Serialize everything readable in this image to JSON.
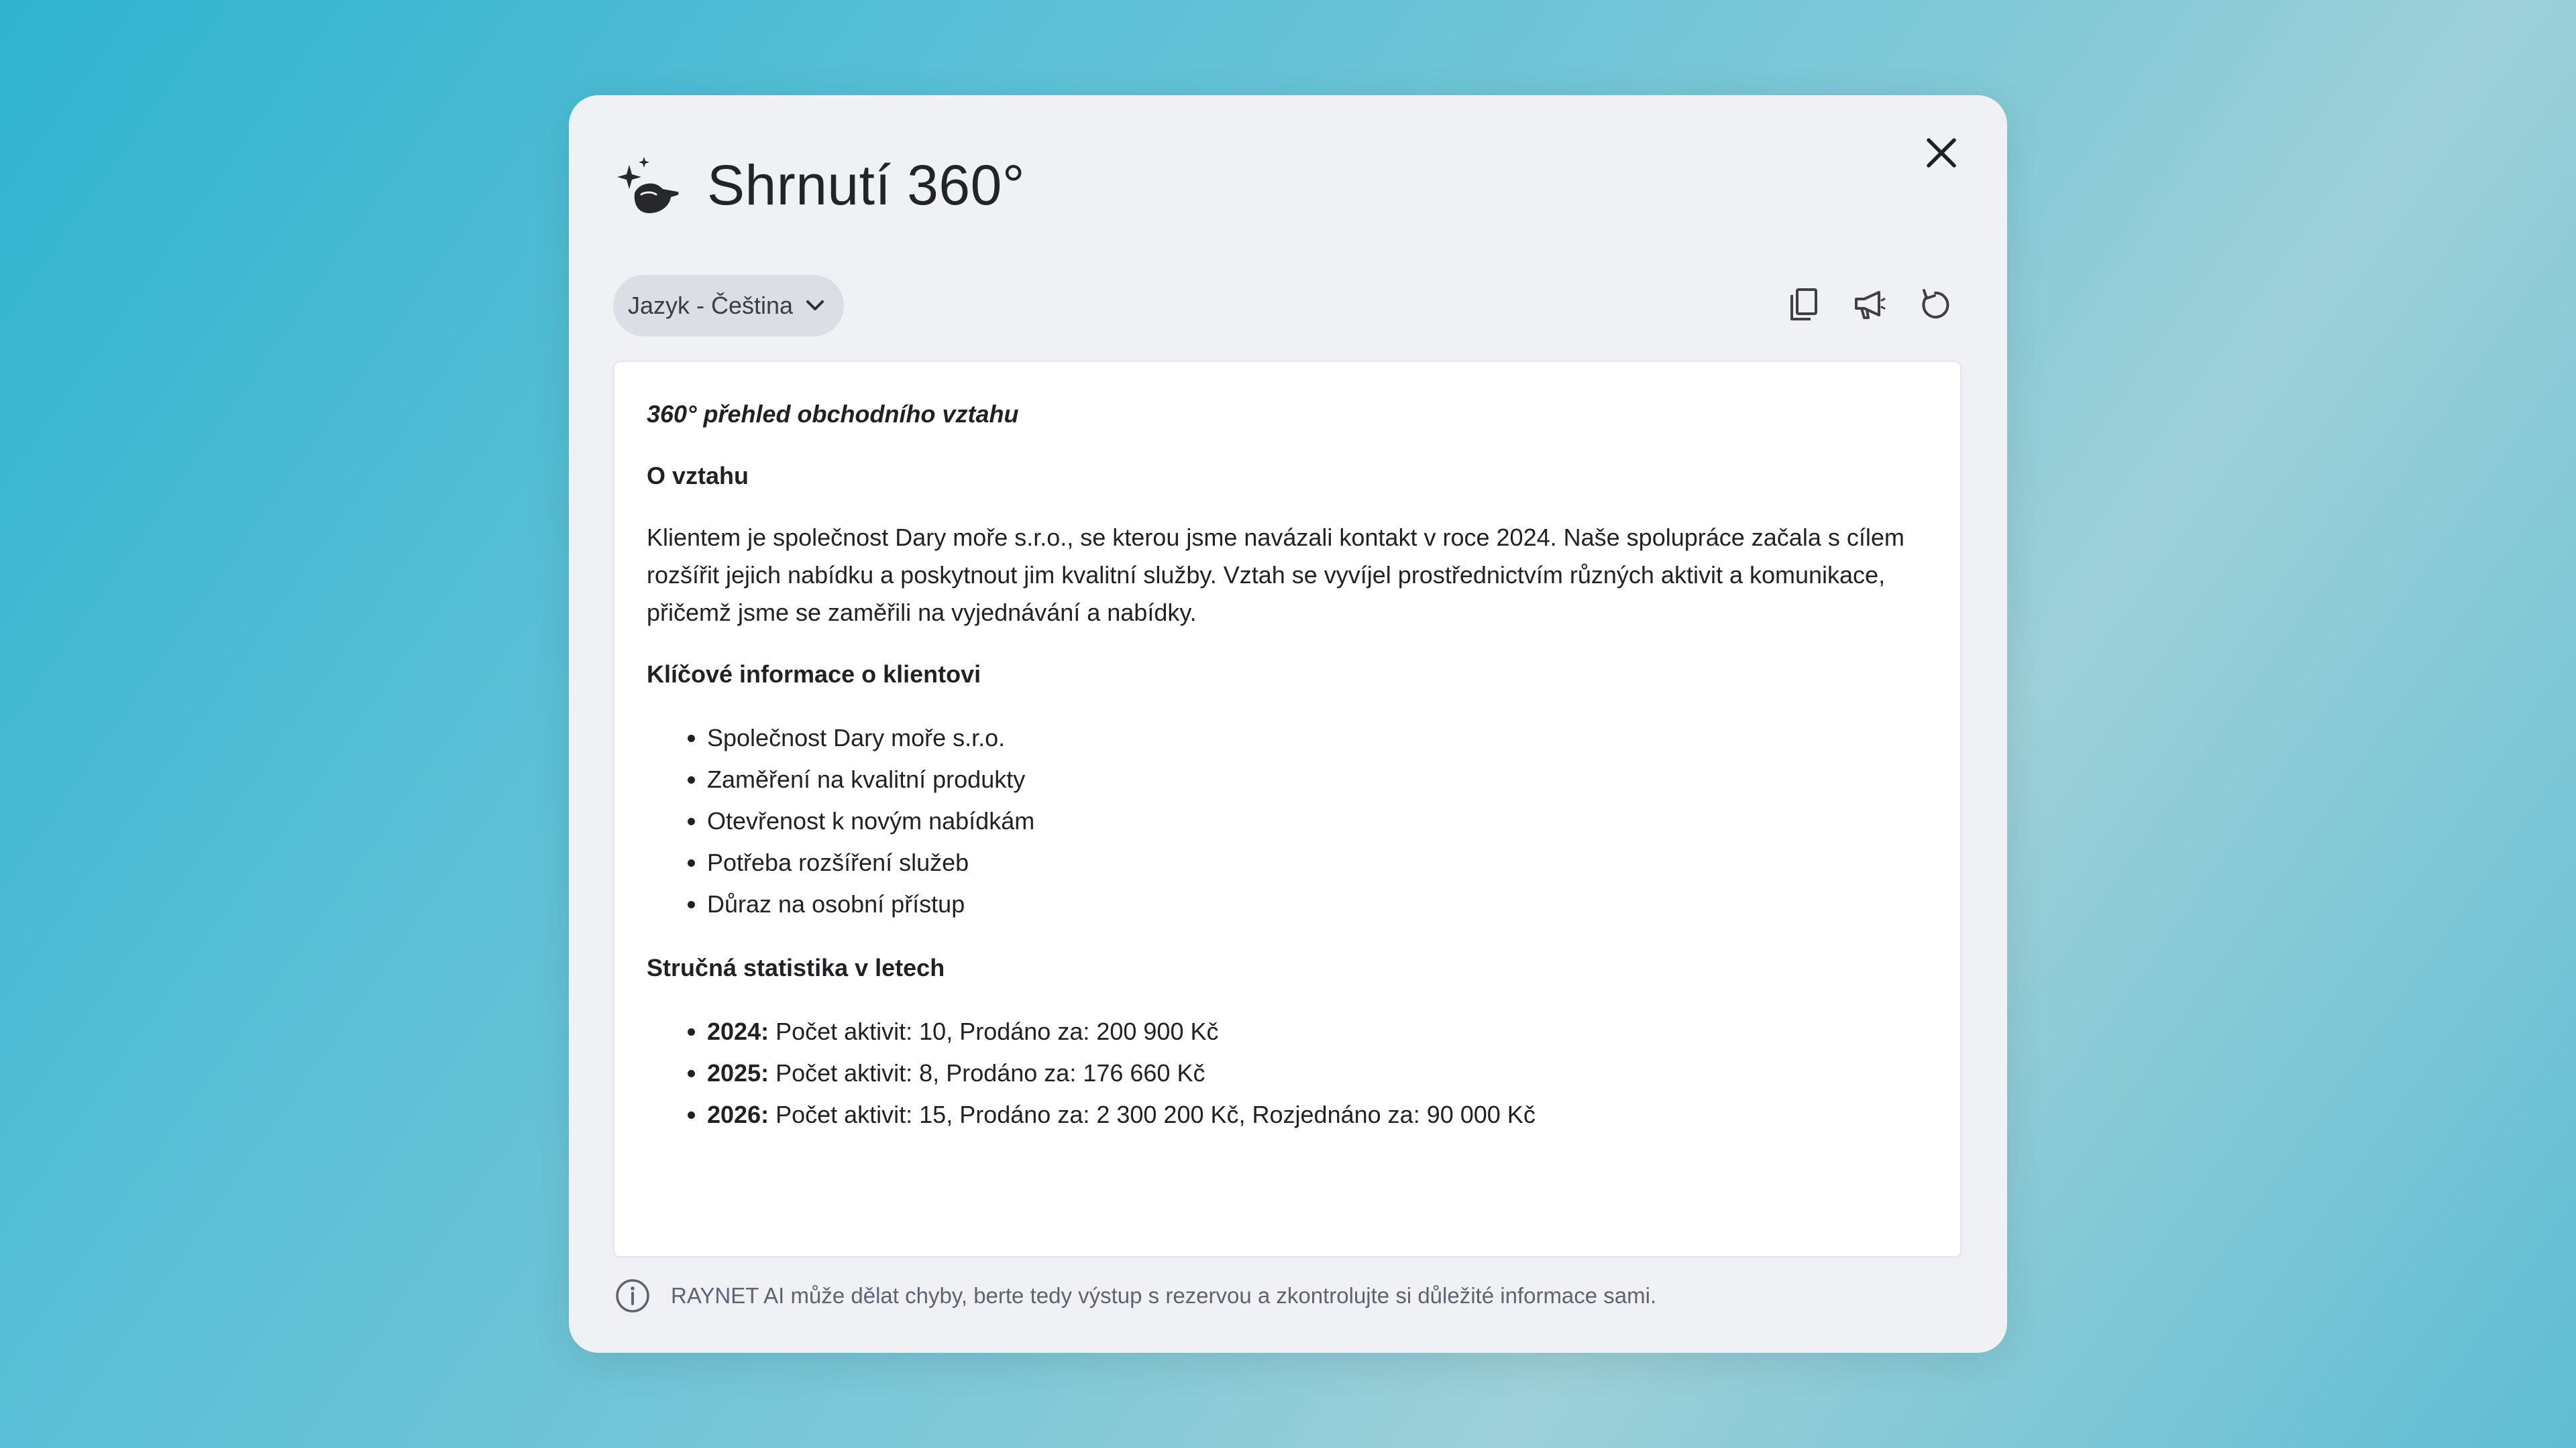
{
  "modal": {
    "title": "Shrnutí 360°",
    "header_icon": "sparkle-hand-icon",
    "close_icon": "close-icon"
  },
  "toolbar": {
    "language_label": "Jazyk - Čeština",
    "language_chevron": "chevron-down-icon",
    "actions": [
      {
        "name": "copy-icon"
      },
      {
        "name": "megaphone-icon"
      },
      {
        "name": "refresh-icon"
      }
    ]
  },
  "summary": {
    "doc_title": "360° přehled obchodního vztahu",
    "section_relationship": {
      "heading": "O vztahu",
      "text": "Klientem je společnost Dary moře s.r.o., se kterou jsme navázali kontakt v roce 2024. Naše spolupráce začala s cílem rozšířit jejich nabídku a poskytnout jim kvalitní služby. Vztah se vyvíjel prostřednictvím různých aktivit a komunikace, přičemž jsme se zaměřili na vyjednávání a nabídky."
    },
    "section_key_info": {
      "heading": "Klíčové informace o klientovi",
      "items": [
        "Společnost Dary moře s.r.o.",
        "Zaměření na kvalitní produkty",
        "Otevřenost k novým nabídkám",
        "Potřeba rozšíření služeb",
        "Důraz na osobní přístup"
      ]
    },
    "section_stats": {
      "heading": "Stručná statistika v letech",
      "items": [
        {
          "year": "2024:",
          "text": " Počet aktivit: 10, Prodáno za: 200 900 Kč"
        },
        {
          "year": "2025:",
          "text": " Počet aktivit: 8, Prodáno za: 176 660 Kč"
        },
        {
          "year": "2026:",
          "text": " Počet aktivit: 15, Prodáno za: 2 300 200 Kč, Rozjednáno za: 90 000 Kč"
        }
      ]
    }
  },
  "footer": {
    "note": "RAYNET AI může dělat chyby, berte tedy výstup s rezervou a zkontrolujte si důležité informace sami.",
    "icon": "info-icon"
  },
  "colors": {
    "modal_bg": "#f0f1f4",
    "content_bg": "#ffffff",
    "select_bg": "#dcdee5",
    "text": "#1f2125",
    "muted": "#5d6370"
  }
}
